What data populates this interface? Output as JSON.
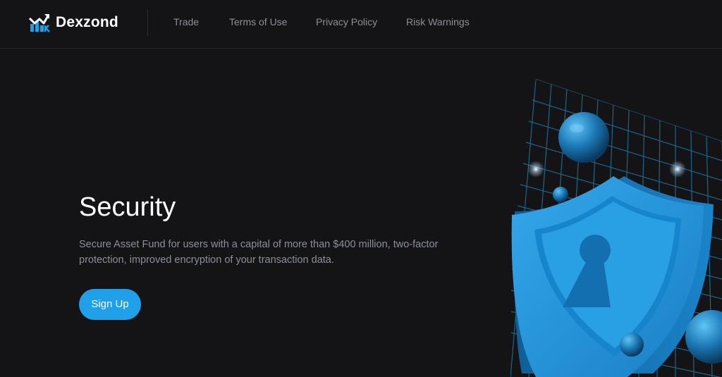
{
  "brand": {
    "name": "Dexzond",
    "logo_icon": "chart-growth-logo-icon",
    "accent": "#1fa0e8"
  },
  "nav": {
    "items": [
      {
        "label": "Trade"
      },
      {
        "label": "Terms of Use"
      },
      {
        "label": "Privacy Policy"
      },
      {
        "label": "Risk Warnings"
      }
    ]
  },
  "hero": {
    "title": "Security",
    "description": "Secure Asset Fund for users with a capital of more than $400 million, two-factor protection, improved encryption of your transaction data.",
    "signup_label": "Sign Up"
  },
  "illustration": {
    "icon": "shield-keyhole-icon",
    "colors": {
      "shield": "#2a9fe0",
      "shield_dark": "#136fb0",
      "grid": "#1f6e98",
      "background": "#141416"
    }
  }
}
